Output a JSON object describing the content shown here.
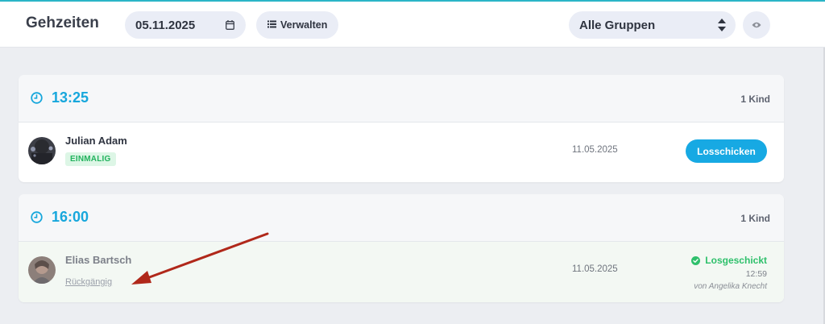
{
  "header": {
    "title": "Gehzeiten",
    "date_value": "05.11.2025",
    "manage_label": "Verwalten",
    "group_select": "Alle Gruppen",
    "icons": {
      "calendar": "calendar-icon",
      "list": "list-icon",
      "select": "updown-icon",
      "eye": "eye-icon"
    }
  },
  "colors": {
    "accent": "#17a9e3",
    "success": "#2ec06b",
    "annotation_arrow": "#b0281a"
  },
  "groups": [
    {
      "time": "13:25",
      "count": "1 Kind",
      "children": [
        {
          "name": "Julian Adam",
          "badge": "EINMALIG",
          "date": "11.05.2025",
          "action": "Losschicken"
        }
      ]
    },
    {
      "time": "16:00",
      "count": "1 Kind",
      "children": [
        {
          "name": "Elias Bartsch",
          "undo": "Rückgängig",
          "date": "11.05.2025",
          "status": "Losgeschickt",
          "sent_time": "12:59",
          "sent_by": "von Angelika Knecht"
        }
      ]
    }
  ]
}
